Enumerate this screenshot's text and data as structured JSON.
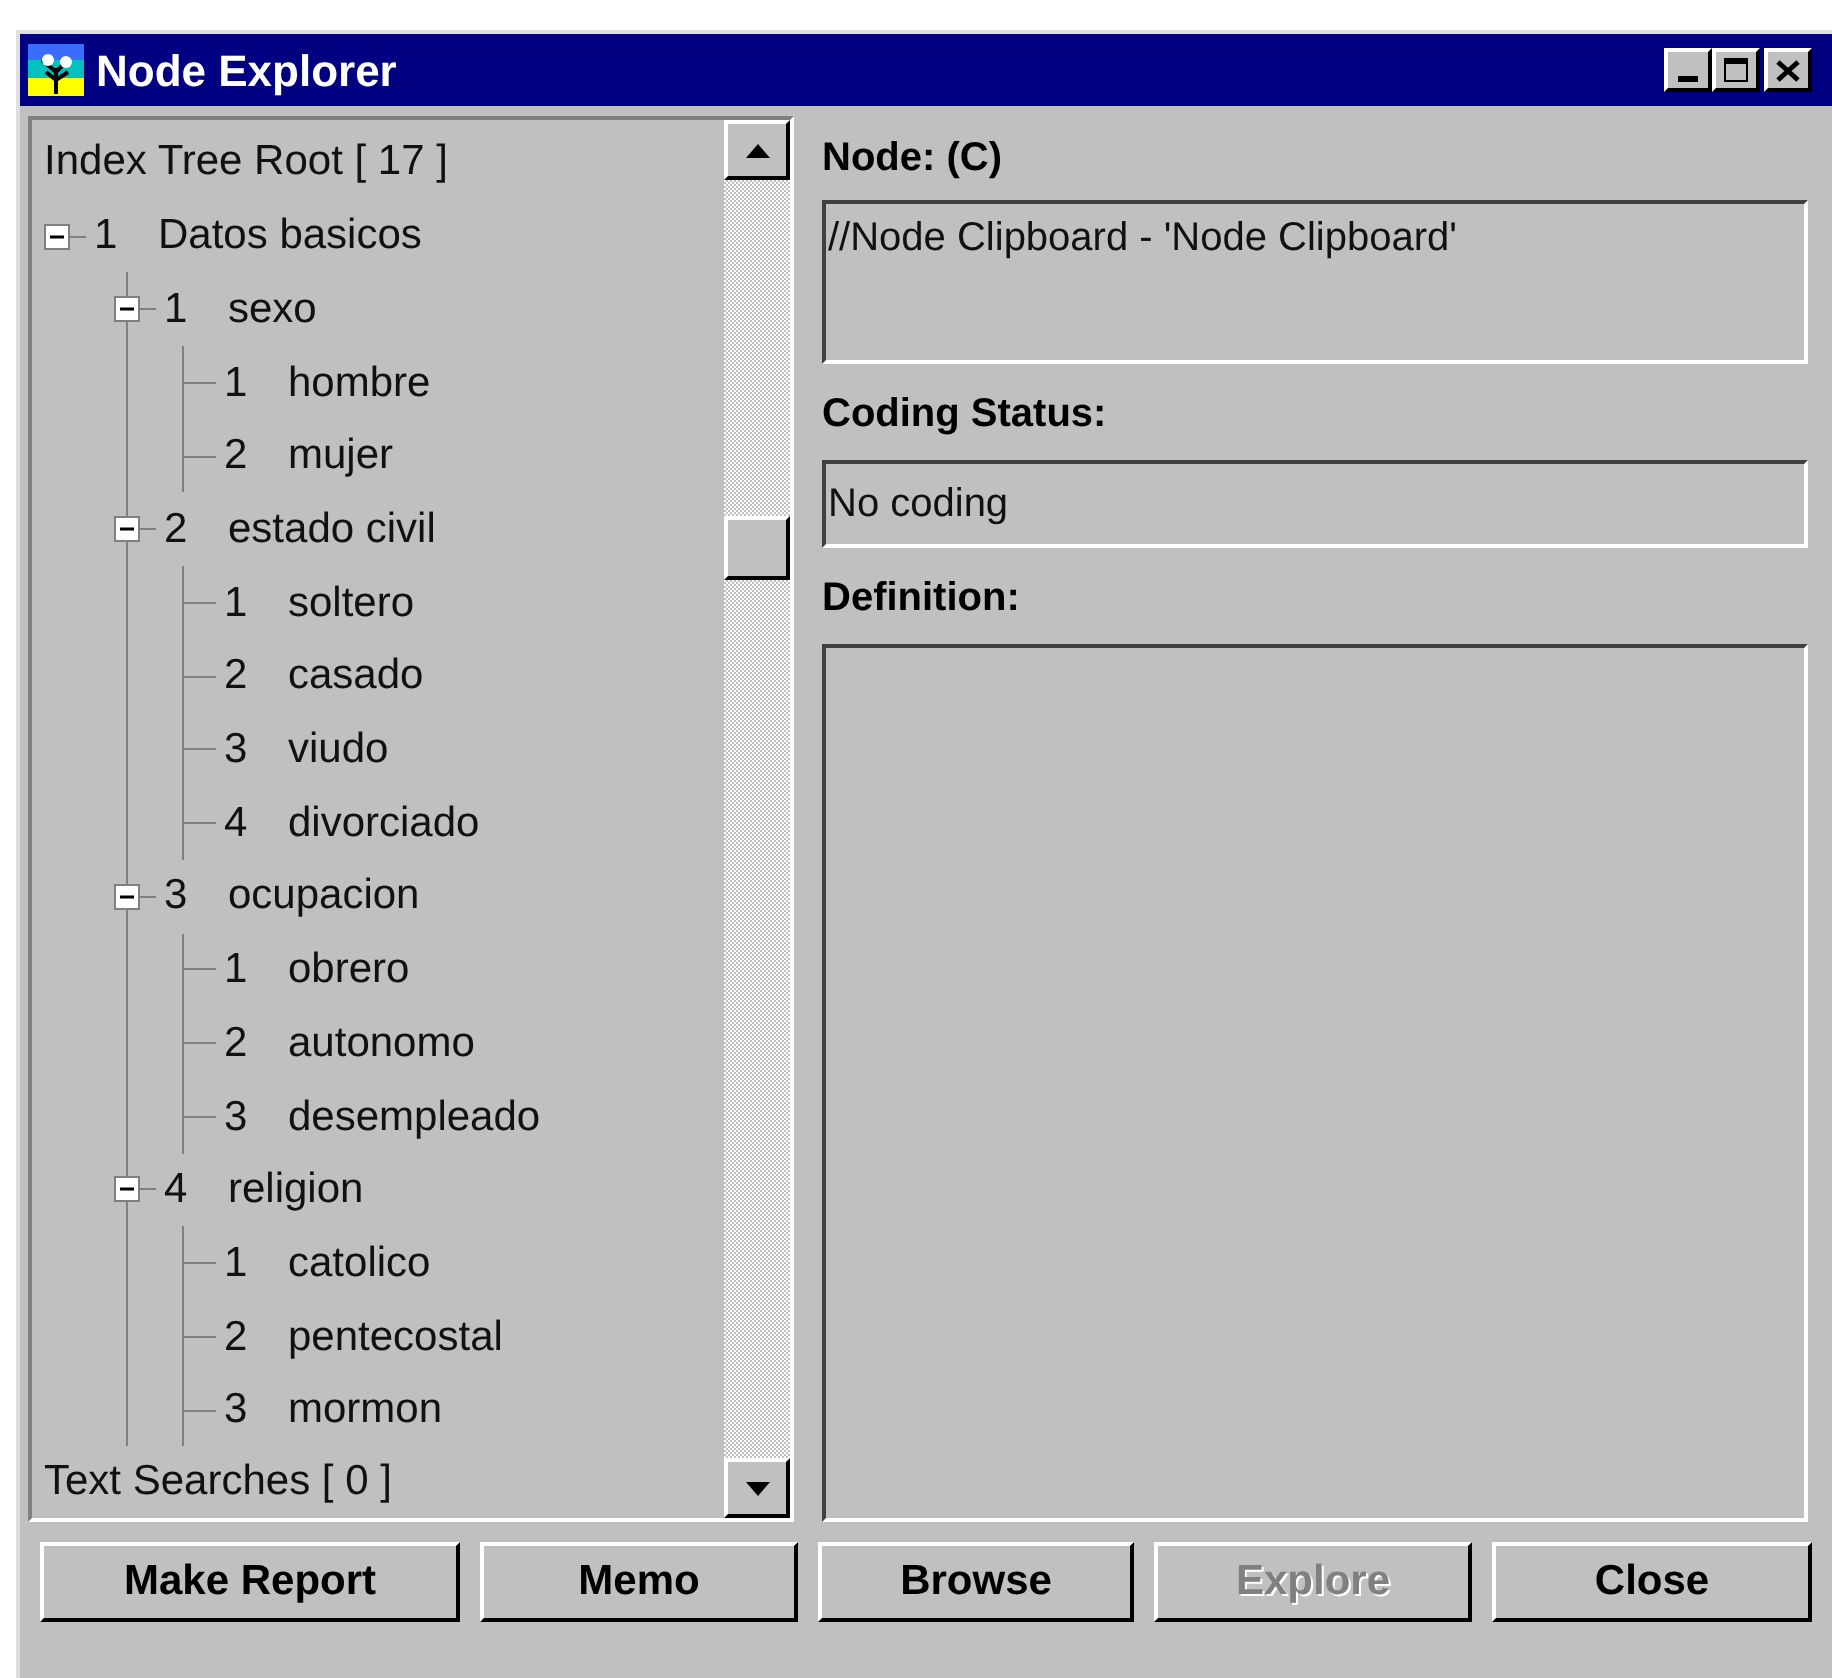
{
  "window": {
    "title": "Node Explorer"
  },
  "tree": {
    "root": "Index Tree Root [ 17 ]",
    "items": [
      {
        "number": "1",
        "label": "Datos basicos",
        "expanded": true,
        "children": [
          {
            "number": "1",
            "label": "sexo",
            "expanded": true,
            "children": [
              {
                "number": "1",
                "label": "hombre"
              },
              {
                "number": "2",
                "label": "mujer"
              }
            ]
          },
          {
            "number": "2",
            "label": "estado civil",
            "expanded": true,
            "children": [
              {
                "number": "1",
                "label": "soltero"
              },
              {
                "number": "2",
                "label": "casado"
              },
              {
                "number": "3",
                "label": "viudo"
              },
              {
                "number": "4",
                "label": "divorciado"
              }
            ]
          },
          {
            "number": "3",
            "label": "ocupacion",
            "expanded": true,
            "children": [
              {
                "number": "1",
                "label": "obrero"
              },
              {
                "number": "2",
                "label": "autonomo"
              },
              {
                "number": "3",
                "label": "desempleado"
              }
            ]
          },
          {
            "number": "4",
            "label": "religion",
            "expanded": true,
            "children": [
              {
                "number": "1",
                "label": "catolico"
              },
              {
                "number": "2",
                "label": "pentecostal"
              },
              {
                "number": "3",
                "label": "mormon"
              }
            ]
          }
        ]
      }
    ],
    "footer": "Text Searches [ 0 ]"
  },
  "node": {
    "label": "Node: (C)",
    "value": "//Node Clipboard - 'Node Clipboard'"
  },
  "coding_status": {
    "label": "Coding Status:",
    "value": "No coding"
  },
  "definition": {
    "label": "Definition:"
  },
  "buttons": [
    {
      "label": "Make Report",
      "disabled": false
    },
    {
      "label": "Memo",
      "disabled": false
    },
    {
      "label": "Browse",
      "disabled": false
    },
    {
      "label": "Explore",
      "disabled": true
    },
    {
      "label": "Close",
      "disabled": false
    }
  ]
}
